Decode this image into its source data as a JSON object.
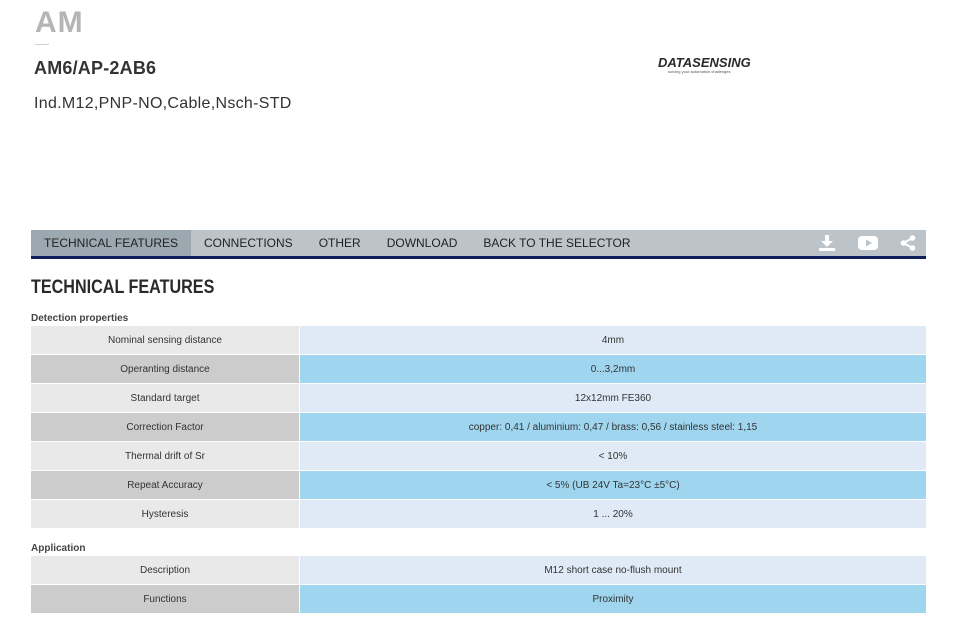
{
  "header": {
    "brand": "AM",
    "model": "AM6/AP-2AB6",
    "description": "Ind.M12,PNP-NO,Cable,Nsch-STD",
    "logo_text": "DATASENSING",
    "logo_tagline": "solving your automation challenges"
  },
  "tabs": [
    {
      "label": "TECHNICAL FEATURES",
      "active": true
    },
    {
      "label": "CONNECTIONS",
      "active": false
    },
    {
      "label": "OTHER",
      "active": false
    },
    {
      "label": "DOWNLOAD",
      "active": false
    },
    {
      "label": "BACK TO THE SELECTOR",
      "active": false
    }
  ],
  "tab_icons": [
    "download-icon",
    "youtube-icon",
    "share-icon"
  ],
  "section_title": "TECHNICAL FEATURES",
  "groups": [
    {
      "label": "Detection properties",
      "rows": [
        {
          "key": "Nominal sensing distance",
          "value": "4mm"
        },
        {
          "key": "Operanting distance",
          "value": "0...3,2mm"
        },
        {
          "key": "Standard target",
          "value": "12x12mm FE360"
        },
        {
          "key": "Correction Factor",
          "value": "copper: 0,41 / aluminium: 0,47 / brass: 0,56 / stainless steel: 1,15"
        },
        {
          "key": "Thermal drift of Sr",
          "value": "< 10%"
        },
        {
          "key": "Repeat Accuracy",
          "value": "< 5% (UB 24V Ta=23°C ±5°C)"
        },
        {
          "key": "Hysteresis",
          "value": "1 ... 20%"
        }
      ]
    },
    {
      "label": "Application",
      "rows": [
        {
          "key": "Description",
          "value": "M12 short case no-flush mount"
        },
        {
          "key": "Functions",
          "value": "Proximity"
        }
      ]
    }
  ],
  "colors": {
    "tabbar_bg": "#bcc4c9",
    "tab_active_bg": "#9ca8af",
    "tabbar_border": "#0f1f5c",
    "row_key_light": "#e9e9e9",
    "row_key_dark": "#cccccc",
    "row_val_light": "#dfeaf6",
    "row_val_dark": "#9fd5ef"
  }
}
